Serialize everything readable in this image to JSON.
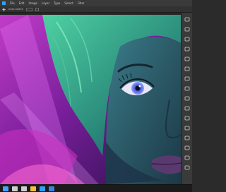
{
  "menubar": {
    "items": [
      "Ps",
      "File",
      "Edit",
      "Image",
      "Layer",
      "Type",
      "Select",
      "Filter"
    ]
  },
  "options": {
    "label": "Auto-Select:"
  },
  "toolbar_icons": [
    "move-icon",
    "marquee-icon",
    "lasso-icon",
    "crop-icon",
    "eyedropper-icon",
    "brush-icon",
    "clone-stamp-icon",
    "eraser-icon",
    "gradient-icon",
    "dodge-icon",
    "pen-icon",
    "type-icon",
    "path-select-icon",
    "shape-icon",
    "hand-icon",
    "zoom-icon"
  ],
  "taskbar_icons": [
    "windows-start-icon",
    "search-icon",
    "task-view-icon",
    "explorer-icon",
    "photoshop-icon",
    "edge-icon"
  ],
  "colors": {
    "accent_purple": "#b23fc2",
    "hair_green": "#3fb28f",
    "skin_teal": "#2e5c66",
    "eye_blue": "#4a5fd0"
  }
}
